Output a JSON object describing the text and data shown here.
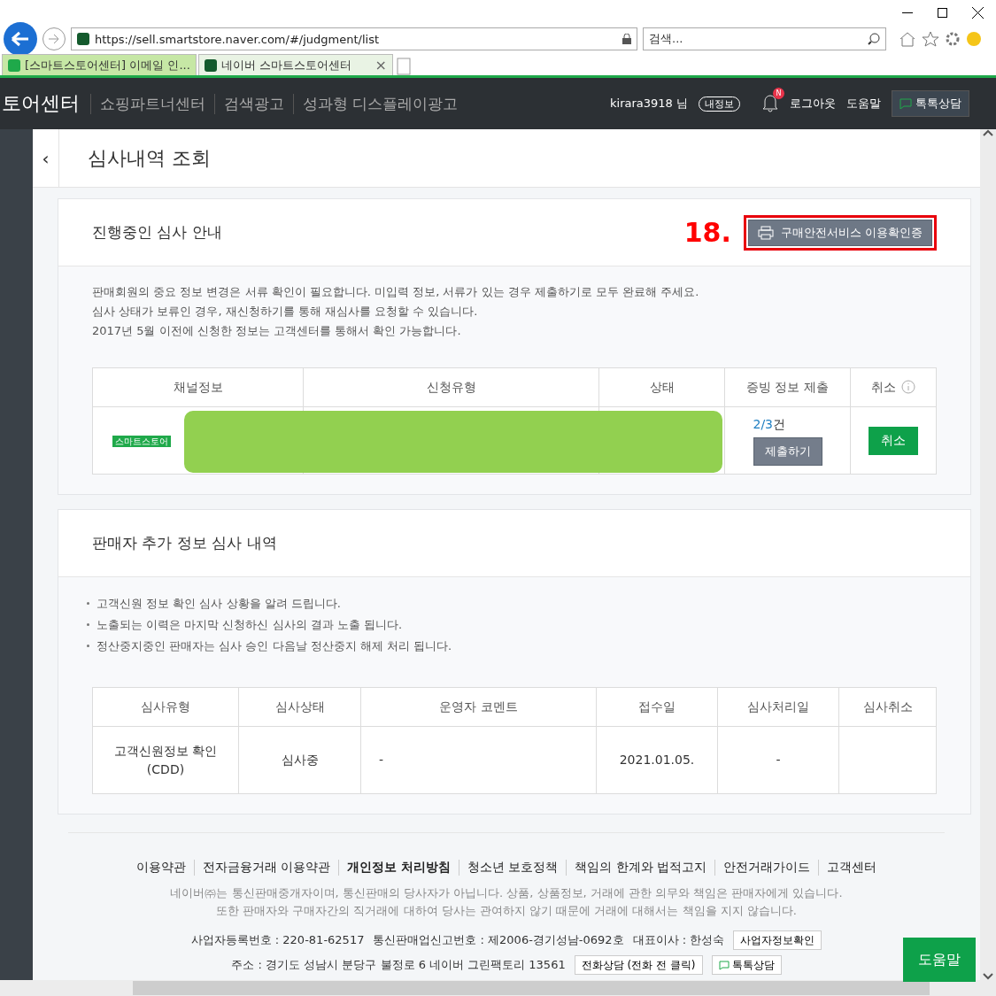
{
  "browser": {
    "address": "https://sell.smartstore.naver.com/#/judgment/list",
    "search_placeholder": "검색...",
    "tabs": [
      {
        "label": "[스마트스토어센터] 이메일 인...",
        "selected": false
      },
      {
        "label": "네이버 스마트스토어센터",
        "selected": true,
        "close": "×"
      }
    ]
  },
  "header": {
    "brand": "토어센터",
    "nav": [
      "쇼핑파트너센터",
      "검색광고",
      "성과형 디스플레이광고"
    ],
    "user": "kirara3918 님",
    "my_info": "내정보",
    "badge": "N",
    "logout": "로그아웃",
    "help": "도움말",
    "talk": "톡톡상담"
  },
  "sidebar": {
    "collapse": "‹"
  },
  "page_title": "심사내역 조회",
  "review_card": {
    "title": "진행중인 심사 안내",
    "annotation": "18.",
    "action": {
      "label": "구매안전서비스 이용확인증",
      "highlighted": true
    },
    "notes": [
      "판매회원의 중요 정보 변경은 서류 확인이 필요합니다. 미입력 정보, 서류가 있는 경우 제출하기로 모두 완료해 주세요.",
      "심사 상태가 보류인 경우, 재신청하기를 통해 재심사를 요청할 수 있습니다.",
      "2017년 5월 이전에 신청한 정보는 고객센터를 통해서 확인 가능합니다."
    ],
    "columns": [
      "채널정보",
      "신청유형",
      "상태",
      "증빙 정보 제출",
      "취소"
    ],
    "rows": [
      {
        "channel": "스마트스토어",
        "count_done": "2/3",
        "count_unit": "건",
        "submit": "제출하기",
        "cancel": "취소",
        "redacted": true
      }
    ]
  },
  "history_card": {
    "title": "판매자 추가 정보 심사 내역",
    "notes": [
      "고객신원 정보 확인 심사 상황을 알려 드립니다.",
      "노출되는 이력은 마지막 신청하신 심사의 결과 노출 됩니다.",
      "정산중지중인 판매자는 심사 승인 다음날 정산중지 해제 처리 됩니다."
    ],
    "columns": [
      "심사유형",
      "심사상태",
      "운영자 코멘트",
      "접수일",
      "심사처리일",
      "심사취소"
    ],
    "rows": [
      {
        "type": "고객신원정보 확인",
        "type_sub": "(CDD)",
        "status": "심사중",
        "comment": "-",
        "received": "2021.01.05.",
        "processed": "-"
      }
    ]
  },
  "footer": {
    "links": [
      {
        "label": "이용약관",
        "bold": false
      },
      {
        "label": "전자금융거래 이용약관",
        "bold": false
      },
      {
        "label": "개인정보 처리방침",
        "bold": true
      },
      {
        "label": "청소년 보호정책",
        "bold": false
      },
      {
        "label": "책임의 한계와 법적고지",
        "bold": false
      },
      {
        "label": "안전거래가이드",
        "bold": false
      },
      {
        "label": "고객센터",
        "bold": false
      }
    ],
    "disclaimer": [
      "네이버㈜는 통신판매중개자이며, 통신판매의 당사자가 아닙니다. 상품, 상품정보, 거래에 관한 의무와 책임은 판매자에게 있습니다.",
      "또한 판매자와 구매자간의 직거래에 대하여 당사는 관여하지 않기 때문에 거래에 대해서는 책임을 지지 않습니다."
    ],
    "info1": [
      "사업자등록번호 : 220-81-62517",
      "통신판매업신고번호 : 제2006-경기성남-0692호",
      "대표이사 : 한성숙"
    ],
    "info1_button": "사업자정보확인",
    "address": "주소 : 경기도 성남시 분당구 불정로 6 네이버 그린팩토리 13561",
    "phone_button": "전화상담 (전화 전 클릭)",
    "talk_button": "톡톡상담"
  },
  "help_button": "도움말"
}
